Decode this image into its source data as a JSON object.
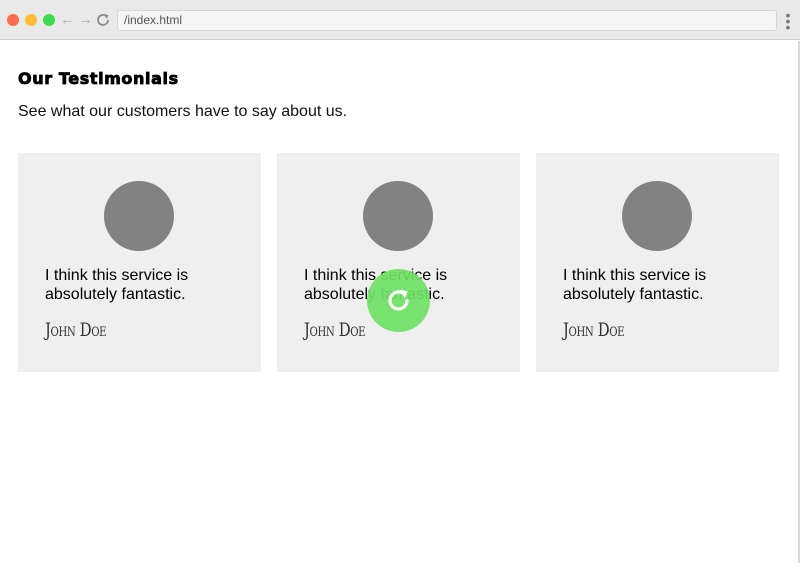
{
  "browser": {
    "url": "/index.html",
    "back_icon": "back-arrow-icon",
    "forward_icon": "forward-arrow-icon",
    "reload_icon": "reload-icon",
    "menu_icon": "kebab-menu-icon"
  },
  "header": {
    "title": "Our Testimonials",
    "subtitle": "See what our customers have to say about us."
  },
  "testimonials": [
    {
      "quote": "I think this service is absolutely fantastic.",
      "author": "John Doe"
    },
    {
      "quote": "I think this service is absolutely fantastic.",
      "author": "John Doe"
    },
    {
      "quote": "I think this service is absolutely fantastic.",
      "author": "John Doe"
    }
  ],
  "overlay": {
    "icon": "refresh-icon",
    "color": "#6ee264"
  },
  "colors": {
    "card_background": "#efefef",
    "avatar": "#828282"
  }
}
